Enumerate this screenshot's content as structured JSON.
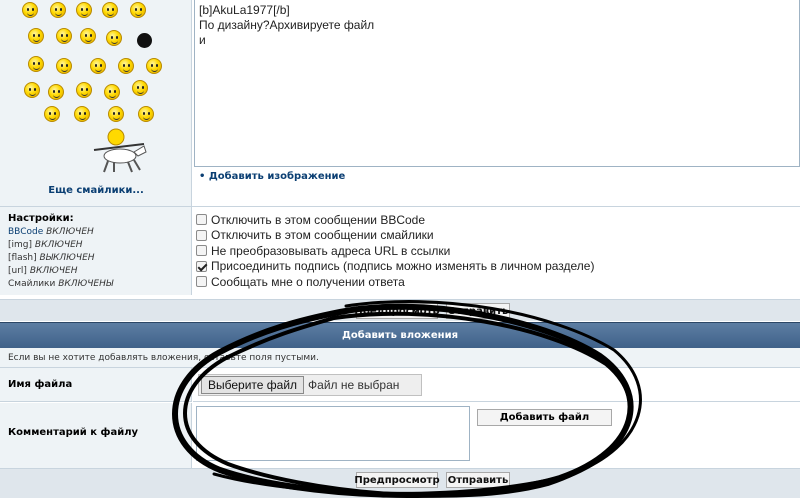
{
  "smilies": {
    "more_link": "Еще смайлики..."
  },
  "editor": {
    "lines": [
      "[b]AkuLa1977[/b]",
      "По дизайну?Архивируете файл",
      "и"
    ]
  },
  "add_image_link": "• Добавить изображение",
  "settings": {
    "title": "Настройки:",
    "statuses": [
      {
        "name": "BBCode",
        "value": "ВКЛЮЧЕН"
      },
      {
        "name": "[img]",
        "value": "ВКЛЮЧЕН"
      },
      {
        "name": "[flash]",
        "value": "ВЫКЛЮЧЕН"
      },
      {
        "name": "[url]",
        "value": "ВКЛЮЧЕН"
      },
      {
        "name": "Смайлики",
        "value": "ВКЛЮЧЕНЫ"
      }
    ],
    "options": [
      {
        "label": "Отключить в этом сообщении BBCode",
        "checked": false
      },
      {
        "label": "Отключить в этом сообщении смайлики",
        "checked": false
      },
      {
        "label": "Не преобразовывать адреса URL в ссылки",
        "checked": false
      },
      {
        "label": "Присоединить подпись (подпись можно изменять в личном разделе)",
        "checked": true
      },
      {
        "label": "Сообщать мне о получении ответа",
        "checked": false
      }
    ]
  },
  "buttons": {
    "preview": "Предпросмотр",
    "submit": "Отправить"
  },
  "attachments": {
    "header": "Добавить вложения",
    "hint": "Если вы не хотите добавлять вложения, оставьте поля пустыми.",
    "filename_label": "Имя файла",
    "choose_file": "Выберите файл",
    "no_file": "Файл не выбран",
    "comment_label": "Комментарий к файлу",
    "add_file": "Добавить файл"
  }
}
